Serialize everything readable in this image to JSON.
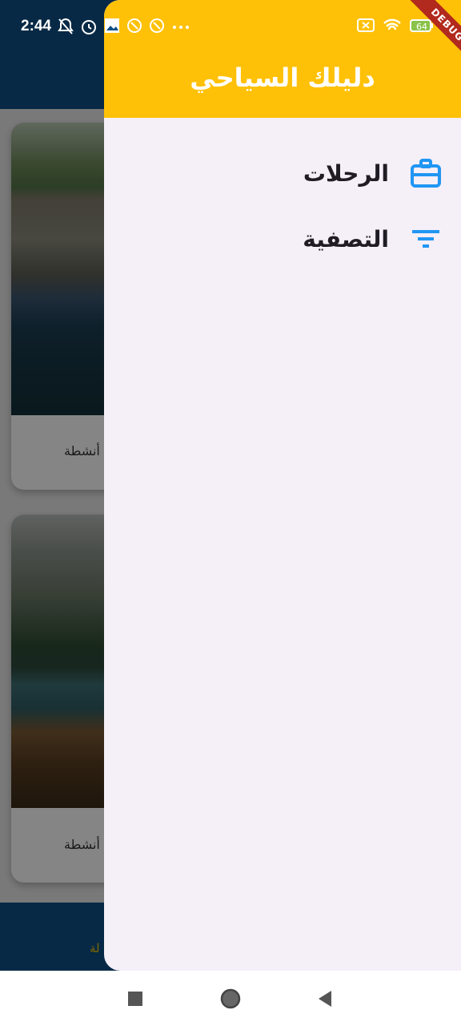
{
  "status_bar": {
    "time": "2:44",
    "left_icons": [
      "notifications-off-icon",
      "alarm-icon",
      "image-icon",
      "app-icon",
      "app-icon",
      "more-icon"
    ],
    "right_icons": [
      "sim-off-icon",
      "wifi-icon",
      "battery-icon"
    ],
    "battery_level": "64"
  },
  "background": {
    "cards": [
      {
        "caption": "أنشطة"
      },
      {
        "caption": "أنشطة"
      }
    ],
    "bottom_nav_label": "لة"
  },
  "drawer": {
    "title": "دليلك السياحي",
    "items": [
      {
        "label": "الرحلات",
        "icon": "briefcase-icon"
      },
      {
        "label": "التصفية",
        "icon": "filter-icon"
      }
    ]
  },
  "debug_banner": "DEBUG",
  "colors": {
    "drawer_header": "#ffc107",
    "drawer_background": "#f5eff8",
    "icon_accent": "#2196f3",
    "app_bar": "#0f4f86"
  }
}
